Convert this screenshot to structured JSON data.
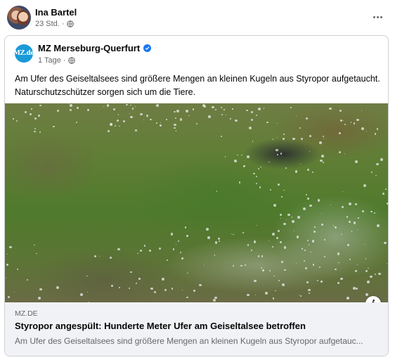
{
  "post": {
    "author_name": "Ina Bartel",
    "time": "23 Std.",
    "separator": "·",
    "more_label": "···"
  },
  "shared": {
    "page_name": "MZ Merseburg-Querfurt",
    "logo_text": "MZ.de",
    "time": "1 Tage",
    "separator": "·",
    "text": "Am Ufer des Geiseltalsees sind größere Mengen an kleinen Kugeln aus Styropor aufgetaucht. Naturschutzschützer sorgen sich um die Tiere.",
    "info_label": "i"
  },
  "link": {
    "domain": "MZ.DE",
    "title": "Styropor angespült: Hunderte Meter Ufer am Geiseltalsee betroffen",
    "description": "Am Ufer des Geiseltalsees sind größere Mengen an kleinen Kugeln aus Styropor aufgetauc..."
  },
  "colors": {
    "verified": "#1877f2",
    "logo_bg": "#1a9ad6",
    "link_bg": "#f0f2f5"
  }
}
